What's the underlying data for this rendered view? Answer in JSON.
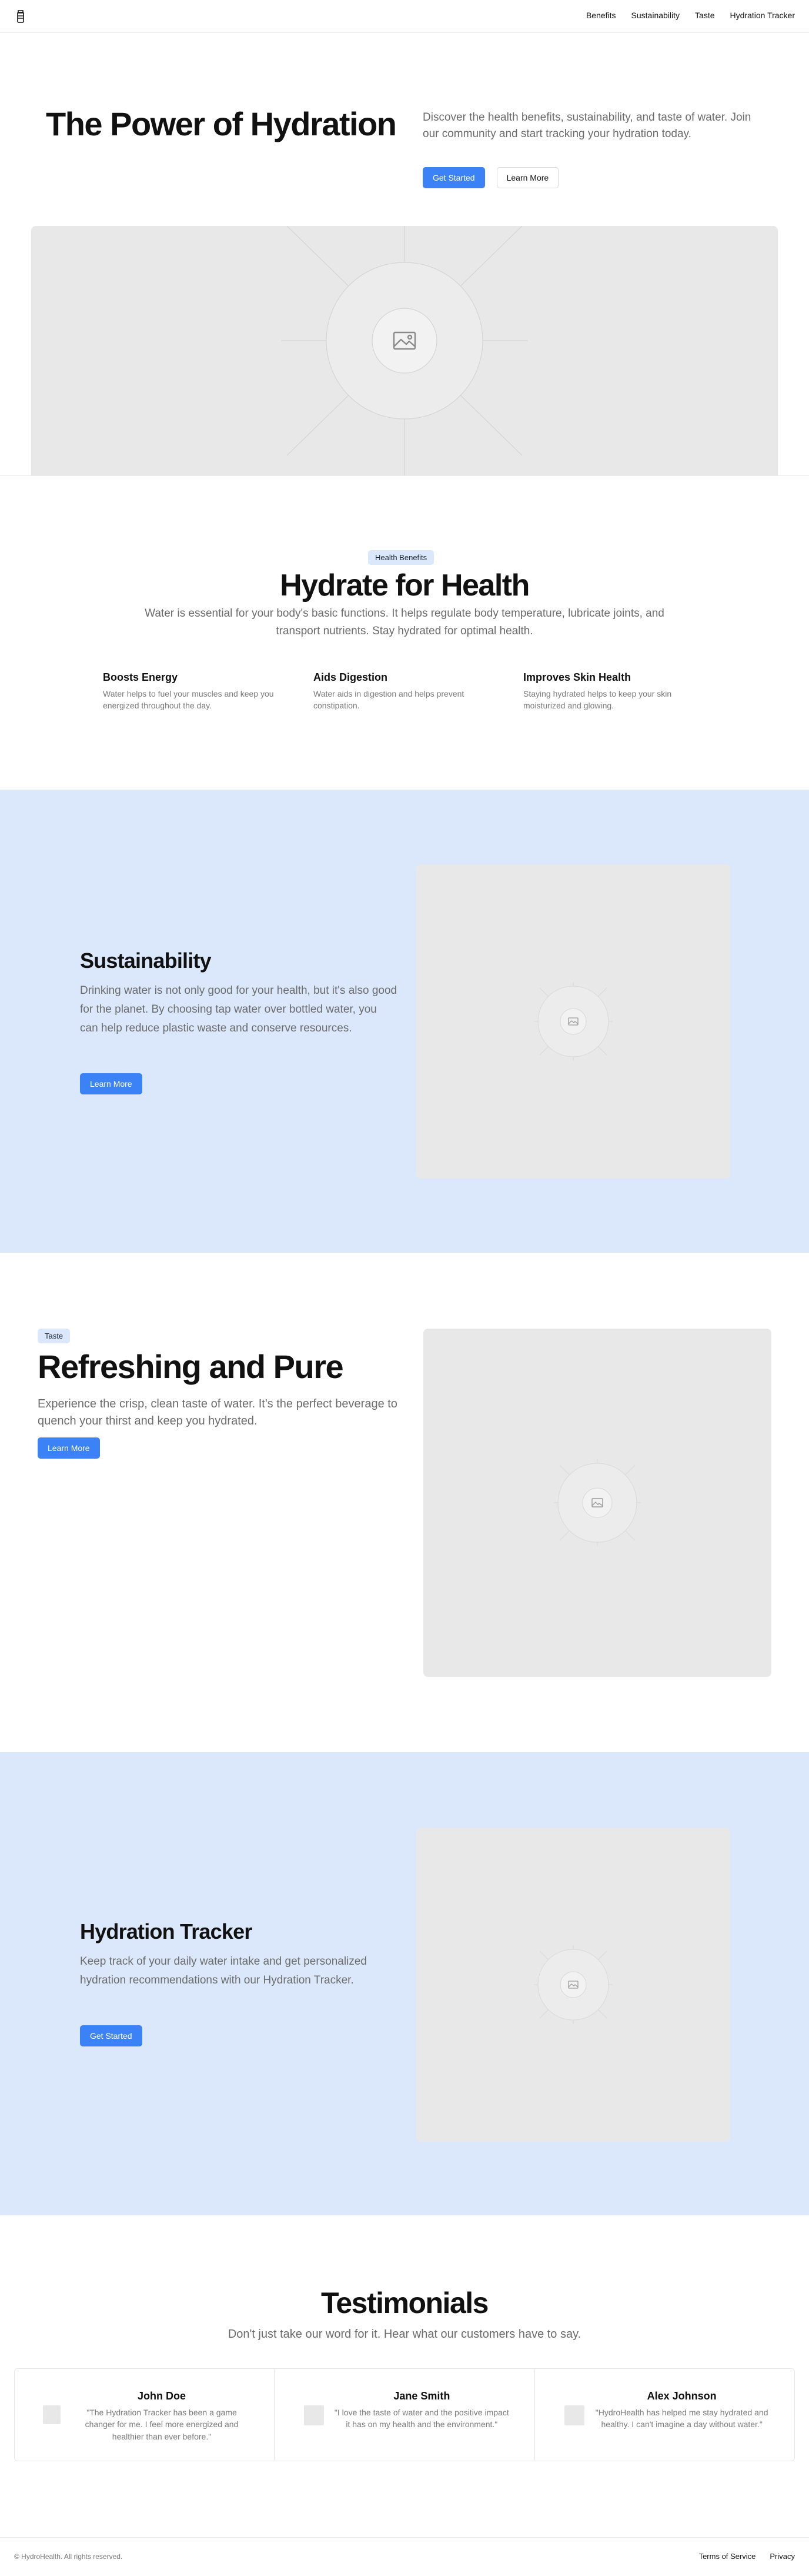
{
  "nav": {
    "logo_icon": "water-bottle-icon",
    "links": [
      "Benefits",
      "Sustainability",
      "Taste",
      "Hydration Tracker"
    ]
  },
  "hero": {
    "title": "The Power of Hydration",
    "description": "Discover the health benefits, sustainability, and taste of water. Join our community and start tracking your hydration today.",
    "primary_button": "Get Started",
    "secondary_button": "Learn More",
    "image_icon": "image-placeholder-icon"
  },
  "health": {
    "badge": "Health Benefits",
    "title": "Hydrate for Health",
    "description": "Water is essential for your body's basic functions. It helps regulate body temperature, lubricate joints, and transport nutrients. Stay hydrated for optimal health.",
    "features": [
      {
        "title": "Boosts Energy",
        "text": "Water helps to fuel your muscles and keep you energized throughout the day."
      },
      {
        "title": "Aids Digestion",
        "text": "Water aids in digestion and helps prevent constipation."
      },
      {
        "title": "Improves Skin Health",
        "text": "Staying hydrated helps to keep your skin moisturized and glowing."
      }
    ]
  },
  "sustainability": {
    "title": "Sustainability",
    "description": "Drinking water is not only good for your health, but it's also good for the planet. By choosing tap water over bottled water, you can help reduce plastic waste and conserve resources.",
    "button": "Learn More"
  },
  "taste": {
    "badge": "Taste",
    "title": "Refreshing and Pure",
    "description": "Experience the crisp, clean taste of water. It's the perfect beverage to quench your thirst and keep you hydrated.",
    "button": "Learn More"
  },
  "tracker": {
    "title": "Hydration Tracker",
    "description": "Keep track of your daily water intake and get personalized hydration recommendations with our Hydration Tracker.",
    "button": "Get Started"
  },
  "testimonials": {
    "title": "Testimonials",
    "subtitle": "Don't just take our word for it. Hear what our customers have to say.",
    "items": [
      {
        "name": "John Doe",
        "quote": "\"The Hydration Tracker has been a game changer for me. I feel more energized and healthier than ever before.\""
      },
      {
        "name": "Jane Smith",
        "quote": "\"I love the taste of water and the positive impact it has on my health and the environment.\""
      },
      {
        "name": "Alex Johnson",
        "quote": "\"HydroHealth has helped me stay hydrated and healthy. I can't imagine a day without water.\""
      }
    ]
  },
  "footer": {
    "copyright": "© HydroHealth. All rights reserved.",
    "links": [
      "Terms of Service",
      "Privacy"
    ]
  },
  "colors": {
    "accent": "#3b82f6",
    "band_background": "#dbe8fc",
    "badge_background": "#dbe8fb",
    "placeholder": "#e8e8e8"
  }
}
